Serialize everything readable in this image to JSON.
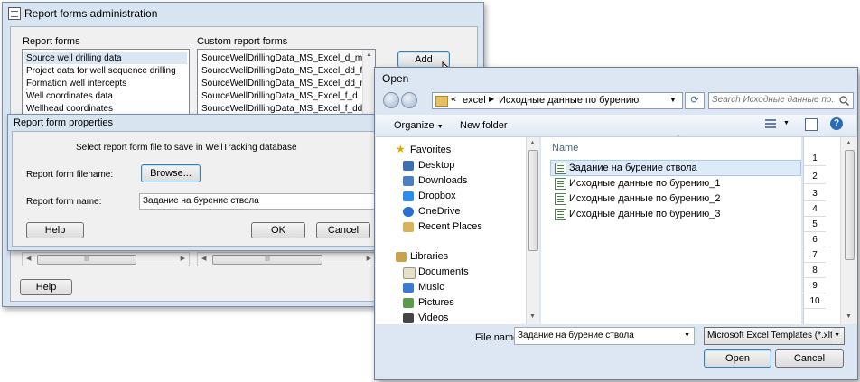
{
  "admin_window": {
    "title": "Report forms administration",
    "report_forms_label": "Report forms",
    "custom_forms_label": "Custom report forms",
    "report_forms": [
      "Source well drilling data",
      "Project data for well sequence drilling",
      "Formation well intercepts",
      "Well coordinates data",
      "Wellhead coordinates"
    ],
    "custom_forms": [
      "SourceWellDrillingData_MS_Excel_d_m_d",
      "SourceWellDrillingData_MS_Excel_dd_f_dd",
      "SourceWellDrillingData_MS_Excel_dd_m_dd",
      "SourceWellDrillingData_MS_Excel_f_d",
      "SourceWellDrillingData_MS_Excel_f_dd"
    ],
    "add_label": "Add",
    "help_label": "Help",
    "scroll_grip": "III"
  },
  "properties_window": {
    "title": "Report form properties",
    "instruction": "Select report form file to save in WellTracking database",
    "filename_label": "Report form filename:",
    "browse_label": "Browse...",
    "name_label": "Report form name:",
    "name_value": "Задание на бурение ствола",
    "help_label": "Help",
    "ok_label": "OK",
    "cancel_label": "Cancel"
  },
  "open_dialog": {
    "title": "Open",
    "breadcrumb": [
      "excel",
      "Исходные данные по бурению"
    ],
    "breadcrumb_chevron": "«",
    "search_placeholder": "Search Исходные данные по...",
    "organize_label": "Organize",
    "new_folder_label": "New folder",
    "nav": {
      "favorites": "Favorites",
      "favorite_items": [
        "Desktop",
        "Downloads",
        "Dropbox",
        "OneDrive",
        "Recent Places"
      ],
      "libraries": "Libraries",
      "library_items": [
        "Documents",
        "Music",
        "Pictures",
        "Videos"
      ]
    },
    "column_name": "Name",
    "files": [
      "Задание на бурение ствола",
      "Исходные данные по бурению_1",
      "Исходные данные по бурению_2",
      "Исходные данные по бурению_3"
    ],
    "preview_rows": [
      "1",
      "2",
      "3",
      "4",
      "5",
      "6",
      "7",
      "8",
      "9",
      "10"
    ],
    "filename_label": "File name:",
    "filename_value": "Задание на бурение ствола",
    "filetype_value": "Microsoft Excel Templates (*.xlt",
    "open_label": "Open",
    "cancel_label": "Cancel"
  },
  "colors": {
    "frame": "#d9e4f1",
    "selection": "#dceaf9",
    "focus_border": "#3c7fb1"
  }
}
